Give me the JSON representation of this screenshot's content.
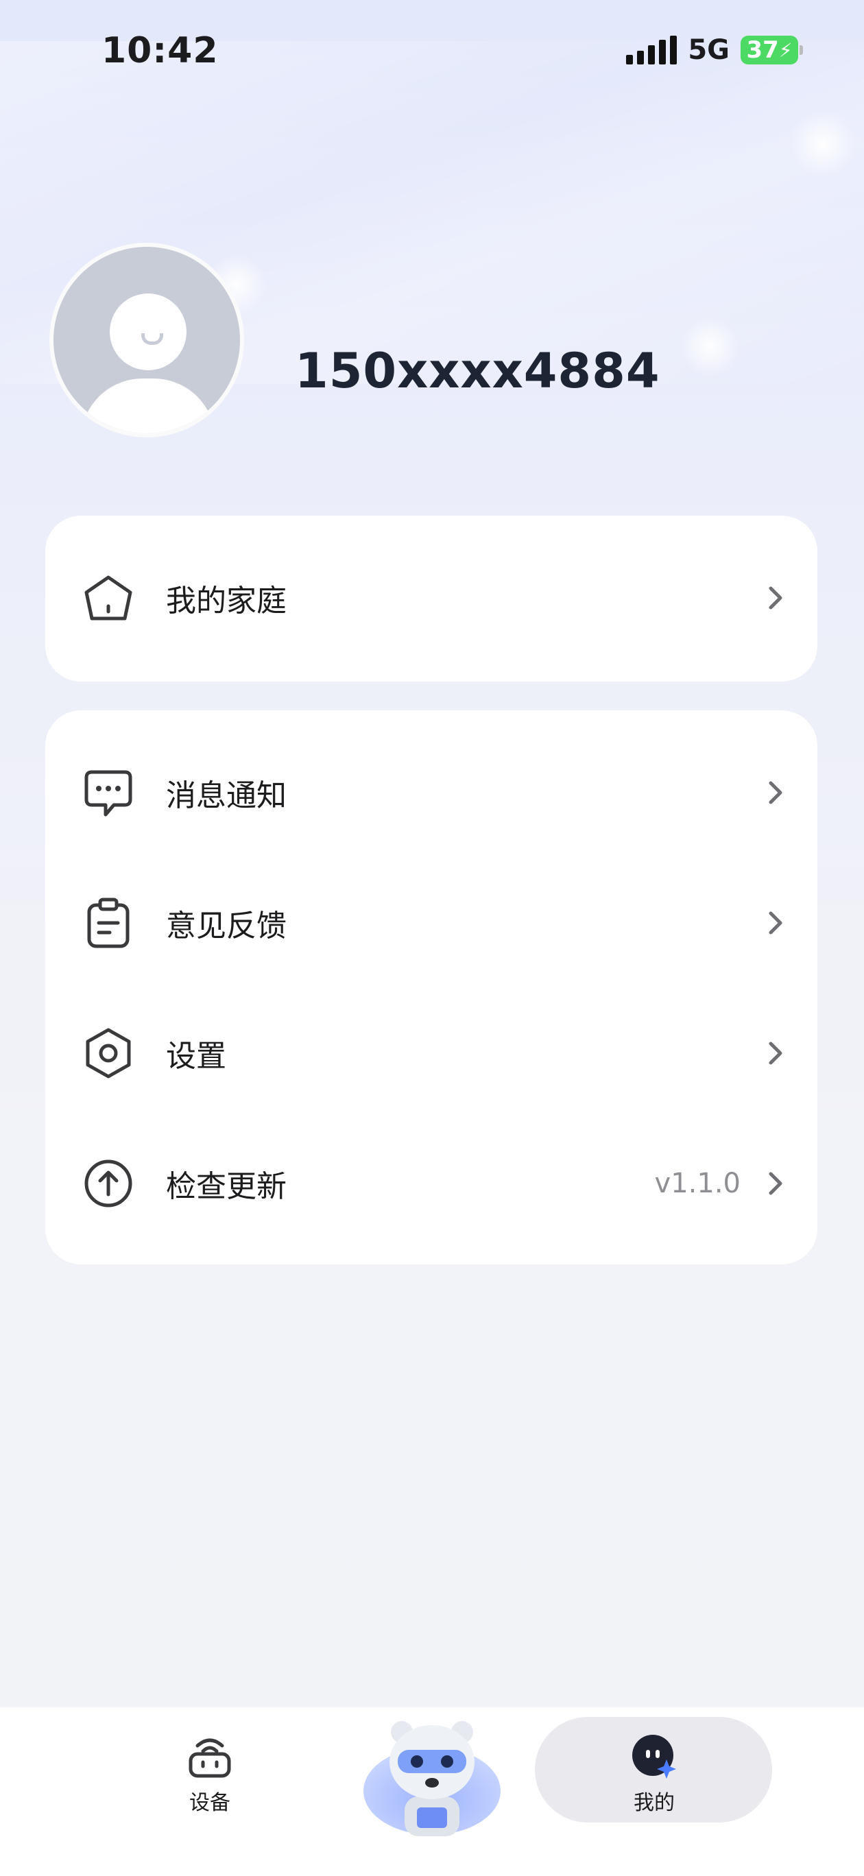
{
  "status_bar": {
    "time": "10:42",
    "network": "5G",
    "battery": "37"
  },
  "profile": {
    "phone": "150xxxx4884"
  },
  "card_home": {
    "items": [
      {
        "label": "我的家庭",
        "icon": "home-icon"
      }
    ]
  },
  "card_menu": {
    "items": [
      {
        "label": "消息通知",
        "icon": "message-bubble-icon"
      },
      {
        "label": "意见反馈",
        "icon": "clipboard-icon"
      },
      {
        "label": "设置",
        "icon": "settings-hexagon-icon"
      },
      {
        "label": "检查更新",
        "icon": "arrow-up-circle-icon",
        "value": "v1.1.0"
      }
    ]
  },
  "tabbar": {
    "devices_label": "设备",
    "mine_label": "我的",
    "center_icon": "robot-bear-mascot-icon"
  },
  "colors": {
    "accent_tab_bg": "#e9e9ee",
    "battery_green": "#4cd964",
    "mascot_blue": "#6f8ef5"
  }
}
